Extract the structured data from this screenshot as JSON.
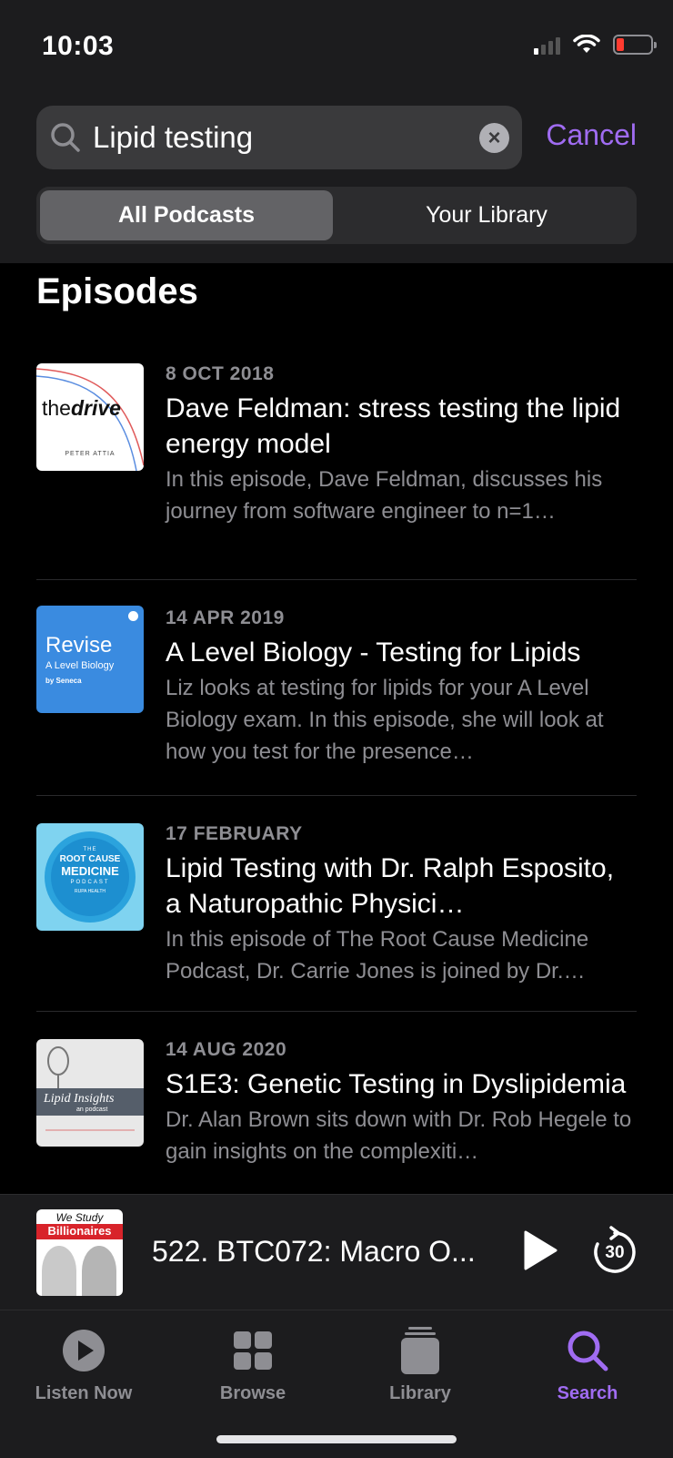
{
  "status": {
    "time": "10:03"
  },
  "search": {
    "query": "Lipid testing",
    "cancel_label": "Cancel"
  },
  "segments": {
    "all_podcasts": "All Podcasts",
    "your_library": "Your Library"
  },
  "section_title": "Episodes",
  "episodes": [
    {
      "date": "8 OCT 2018",
      "title": "Dave Feldman: stress testing the lipid energy model",
      "description": "In this episode, Dave Feldman, discusses his journey from software engineer to n=1…",
      "artwork": {
        "name": "thedrive",
        "brand_prefix": "the",
        "brand_suffix": "drive",
        "host": "PETER ATTIA"
      }
    },
    {
      "date": "14 APR 2019",
      "title": "A Level Biology - Testing for Lipids",
      "description": "Liz looks at testing for lipids for your A Level Biology exam. In this episode, she will look at how you test for the presence…",
      "artwork": {
        "title": "Revise",
        "subtitle": "A Level Biology",
        "byline": "by Seneca"
      }
    },
    {
      "date": "17 FEBRUARY",
      "title": "Lipid Testing with Dr. Ralph Esposito, a Naturopathic Physici…",
      "description": "In this episode of The Root Cause Medicine Podcast, Dr. Carrie Jones is joined by Dr.…",
      "artwork": {
        "line1": "THE",
        "line2": "ROOT CAUSE",
        "line3": "MEDICINE",
        "line4": "PODCAST",
        "line5": "RUPA HEALTH"
      }
    },
    {
      "date": "14 AUG 2020",
      "title": "S1E3: Genetic Testing in Dyslipidemia",
      "description": "Dr. Alan Brown sits down with Dr. Rob Hegele to gain insights on the complexiti…",
      "artwork": {
        "title": "Lipid Insights",
        "sub": "an",
        "sub2": "podcast"
      }
    }
  ],
  "mini_player": {
    "title": "522. BTC072: Macro O...",
    "artwork": {
      "line1": "We Study",
      "line2": "Billionaires"
    },
    "skip_seconds": "30"
  },
  "tabs": [
    {
      "label": "Listen Now",
      "icon": "play-circle-icon"
    },
    {
      "label": "Browse",
      "icon": "grid-icon"
    },
    {
      "label": "Library",
      "icon": "stack-icon"
    },
    {
      "label": "Search",
      "icon": "search-icon"
    }
  ],
  "colors": {
    "accent": "#a06cf2",
    "background": "#000000",
    "bar": "#1c1c1e",
    "secondary_text": "#8e8e93"
  }
}
